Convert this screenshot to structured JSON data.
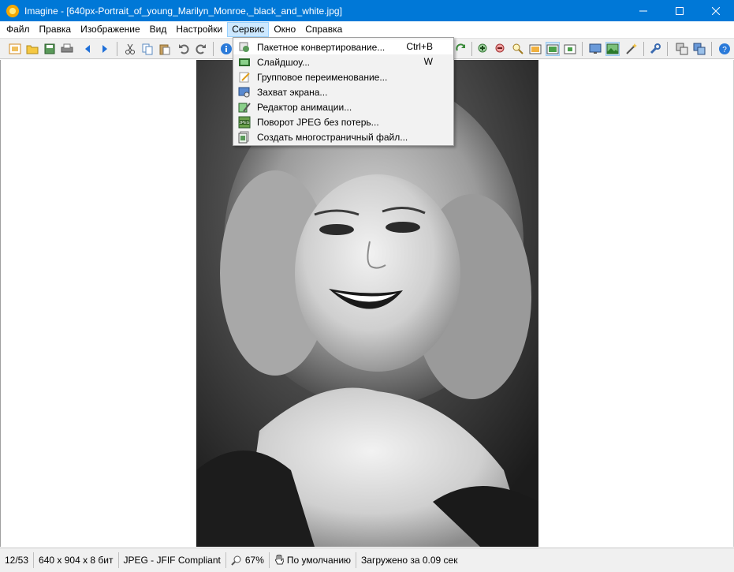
{
  "window": {
    "title": "Imagine - [640px-Portrait_of_young_Marilyn_Monroe,_black_and_white.jpg]",
    "minimize": "—",
    "maximize": "☐",
    "close": "✕"
  },
  "menubar": {
    "items": [
      "Файл",
      "Правка",
      "Изображение",
      "Вид",
      "Настройки",
      "Сервис",
      "Окно",
      "Справка"
    ],
    "active": "Сервис"
  },
  "service_menu": {
    "items": [
      {
        "label": "Пакетное конвертирование...",
        "shortcut": "Ctrl+B",
        "icon": "batch-convert-icon"
      },
      {
        "label": "Слайдшоу...",
        "shortcut": "W",
        "icon": "slideshow-icon"
      },
      {
        "label": "Групповое переименование...",
        "shortcut": "",
        "icon": "batch-rename-icon"
      },
      {
        "label": "Захват экрана...",
        "shortcut": "",
        "icon": "screen-capture-icon"
      },
      {
        "label": "Редактор анимации...",
        "shortcut": "",
        "icon": "animation-editor-icon"
      },
      {
        "label": "Поворот JPEG без потерь...",
        "shortcut": "",
        "icon": "jpeg-lossless-rotate-icon"
      },
      {
        "label": "Создать многостраничный файл...",
        "shortcut": "",
        "icon": "multipage-file-icon"
      }
    ]
  },
  "statusbar": {
    "index": "12/53",
    "dimensions": "640 x 904 x 8 бит",
    "format": "JPEG - JFIF Compliant",
    "zoom": "67%",
    "mode": "По умолчанию",
    "load_time": "Загружено за 0.09 сек"
  },
  "colors": {
    "titlebar": "#0078d7",
    "menu_highlight": "#cce8ff",
    "dropdown_bg": "#f2f2f2"
  }
}
